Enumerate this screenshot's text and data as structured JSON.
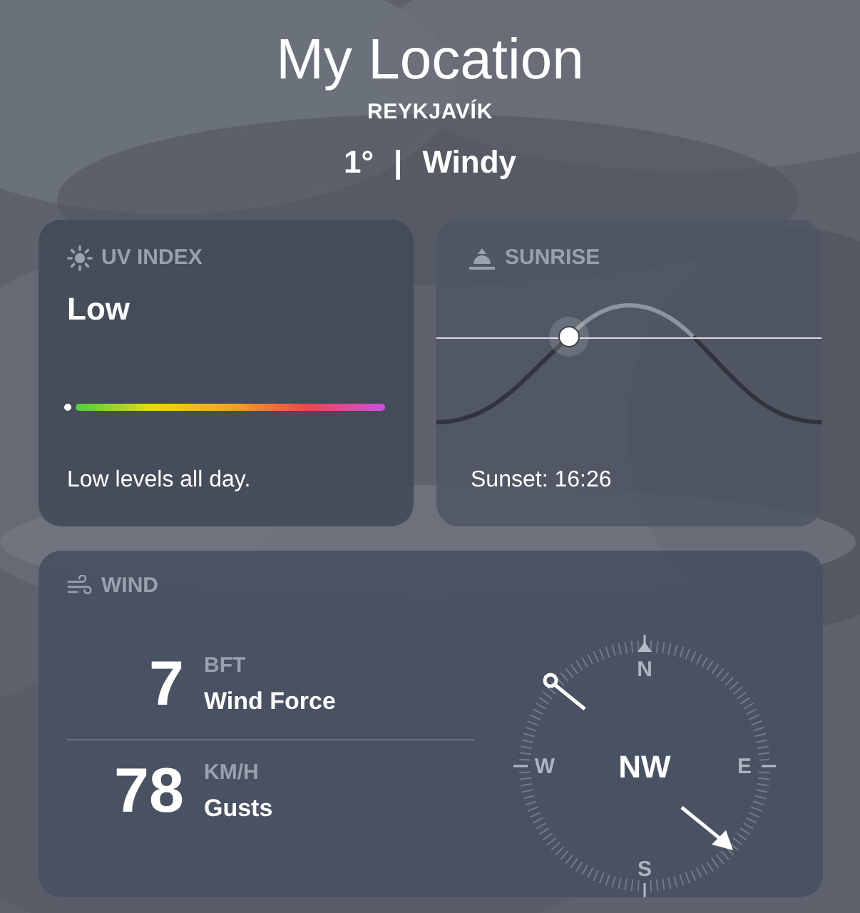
{
  "header": {
    "title": "My Location",
    "city": "REYKJAVÍK",
    "temperature": "1°",
    "separator": "|",
    "condition": "Windy"
  },
  "uv_index": {
    "heading": "UV INDEX",
    "value": "Low",
    "level": 0,
    "summary": "Low levels all day."
  },
  "sunrise": {
    "heading": "SUNRISE",
    "footer": "Sunset: 16:26"
  },
  "wind": {
    "heading": "WIND",
    "rows": [
      {
        "value": "7",
        "unit": "BFT",
        "label": "Wind Force"
      },
      {
        "value": "78",
        "unit": "KM/H",
        "label": "Gusts"
      }
    ],
    "compass": {
      "north": "N",
      "east": "E",
      "south": "S",
      "west": "W",
      "direction": "NW"
    }
  }
}
